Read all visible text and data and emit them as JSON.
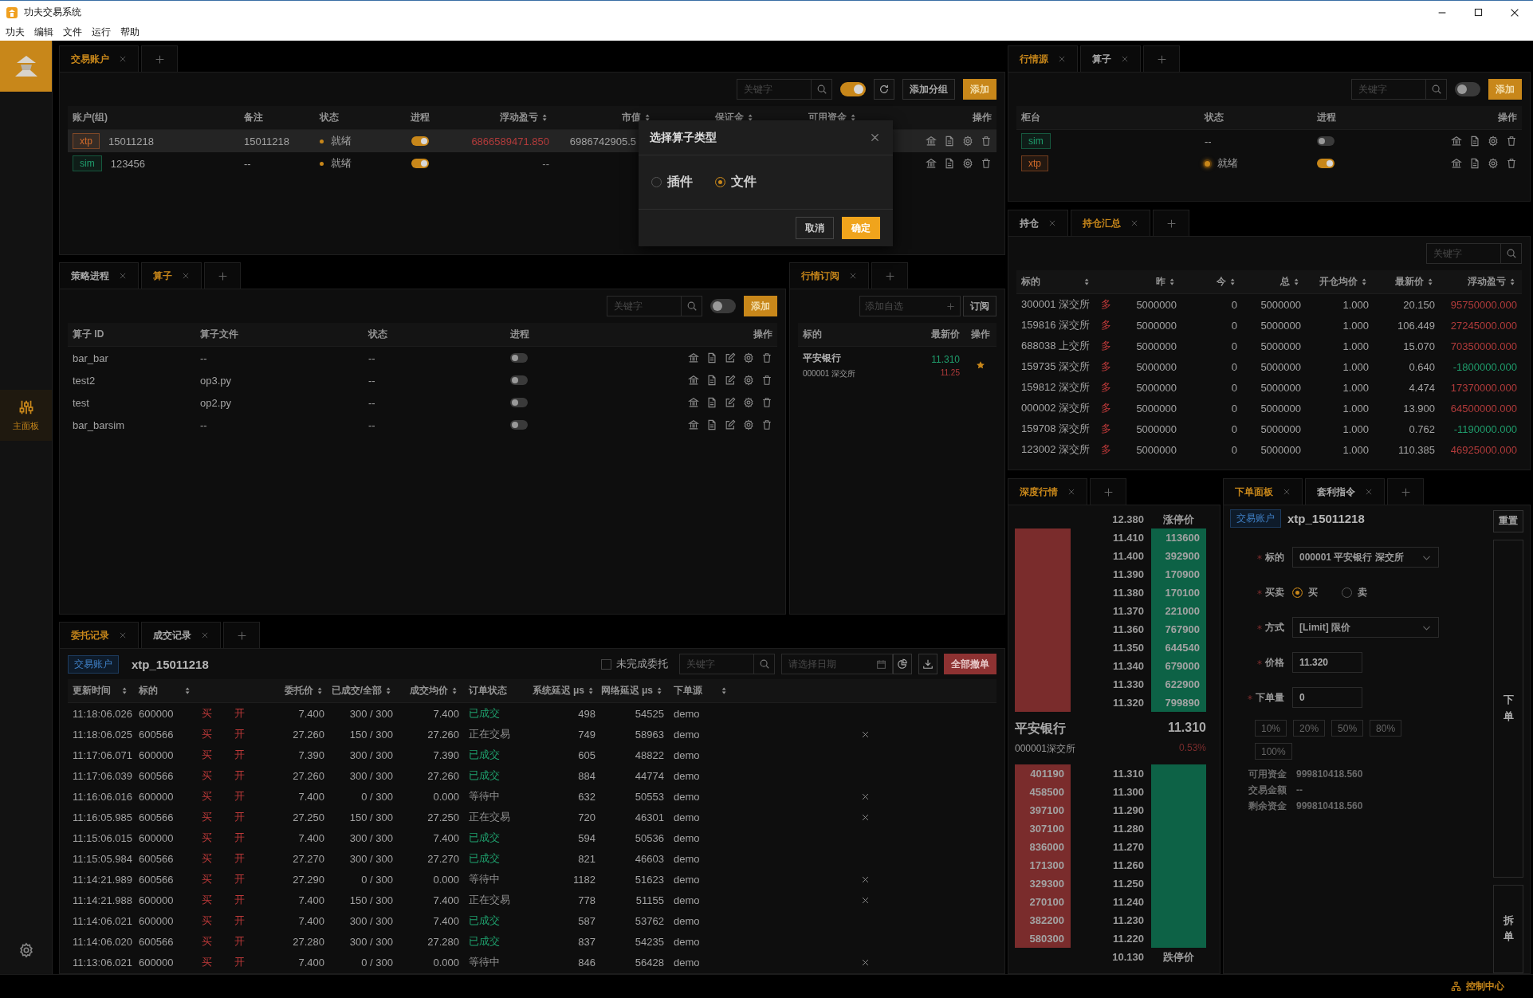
{
  "window": {
    "title": "功夫交易系统"
  },
  "menu": [
    "功夫",
    "编辑",
    "文件",
    "运行",
    "帮助"
  ],
  "sidebar": {
    "items": [
      {
        "label": "主面板",
        "selected": true
      }
    ]
  },
  "account_panel": {
    "tabs": [
      {
        "label": "交易账户",
        "selected": true
      }
    ],
    "search": {
      "placeholder": "关键字"
    },
    "toggle_on": true,
    "buttons": [
      {
        "label": "添加分组",
        "kind": "default"
      },
      {
        "label": "添加",
        "kind": "primary"
      }
    ],
    "columns": [
      {
        "label": "账户(组)",
        "sortable": false
      },
      {
        "label": "备注",
        "sortable": false
      },
      {
        "label": "状态",
        "sortable": false
      },
      {
        "label": "进程",
        "sortable": false
      },
      {
        "label": "浮动盈亏",
        "sortable": true
      },
      {
        "label": "市值",
        "sortable": true
      },
      {
        "label": "保证金",
        "sortable": true
      },
      {
        "label": "可用资金",
        "sortable": true
      },
      {
        "label": "操作",
        "sortable": false
      }
    ],
    "rows": [
      {
        "tag": "xtp",
        "color": "#d06a2a",
        "account": "15011218",
        "note": "15011218",
        "status": "就绪",
        "ready": true,
        "process_on": true,
        "pnl": "6866589471.850",
        "pnl_up": true,
        "market_value": "6986742905.5",
        "selected": true
      },
      {
        "tag": "sim",
        "color": "#1f9d6c",
        "account": "123456",
        "note": "--",
        "status": "就绪",
        "ready": true,
        "process_on": true,
        "pnl": "--",
        "pnl_up": false,
        "selected": false
      }
    ]
  },
  "strategy_panel": {
    "tabs": [
      {
        "label": "策略进程",
        "selected": false
      },
      {
        "label": "算子",
        "selected": true
      }
    ],
    "search": {
      "placeholder": "关键字"
    },
    "toggle_on": false,
    "add_button": "添加",
    "columns": [
      {
        "label": "算子 ID"
      },
      {
        "label": "算子文件"
      },
      {
        "label": "状态"
      },
      {
        "label": "进程"
      },
      {
        "label": "操作"
      }
    ],
    "rows": [
      {
        "id": "bar_bar",
        "file": "--",
        "status": "--",
        "process_on": false
      },
      {
        "id": "test2",
        "file": "op3.py",
        "status": "--",
        "process_on": false
      },
      {
        "id": "test",
        "file": "op2.py",
        "status": "--",
        "process_on": false
      },
      {
        "id": "bar_barsim",
        "file": "--",
        "status": "--",
        "process_on": false
      }
    ]
  },
  "subscription_panel": {
    "tabs": [
      {
        "label": "行情订阅",
        "selected": true
      }
    ],
    "add_field": {
      "placeholder": "添加自选"
    },
    "subscribe_button": "订阅",
    "columns": [
      {
        "label": "标的"
      },
      {
        "label": "最新价"
      },
      {
        "label": "操作"
      }
    ],
    "rows": [
      {
        "name": "平安银行",
        "code": "000001 深交所",
        "last": "11.310",
        "prev": "11.25",
        "starred": true
      }
    ]
  },
  "orders_panel": {
    "tabs": [
      {
        "label": "委托记录",
        "selected": true
      },
      {
        "label": "成交记录",
        "selected": false
      }
    ],
    "account_badge": "交易账户",
    "account": "xtp_15011218",
    "filter_checkbox": {
      "label": "未完成委托",
      "checked": false
    },
    "search": {
      "placeholder": "关键字"
    },
    "date_field": {
      "placeholder": "请选择日期"
    },
    "cancel_all_button": "全部撤单",
    "columns": [
      {
        "label": "更新时间",
        "sortable": true
      },
      {
        "label": "标的",
        "sortable": true
      },
      null,
      null,
      {
        "label": "委托价",
        "sortable": true
      },
      {
        "label": "已成交/全部",
        "sortable": true
      },
      {
        "label": "成交均价",
        "sortable": true
      },
      {
        "label": "订单状态",
        "sortable": false
      },
      {
        "label": "系统延迟 μs",
        "sortable": true
      },
      {
        "label": "网络延迟 μs",
        "sortable": true
      },
      {
        "label": "下单源",
        "sortable": true
      },
      null
    ],
    "rows": [
      {
        "time": "11:18:06.026",
        "code": "600000",
        "side": "买",
        "offset": "开",
        "price": "7.400",
        "filled": "300 / 300",
        "avg_price": "7.400",
        "status": "已成交",
        "filled_status": true,
        "sys_latency": "498",
        "net_latency": "54525",
        "source": "demo",
        "cancelable": false
      },
      {
        "time": "11:18:06.025",
        "code": "600566",
        "side": "买",
        "offset": "开",
        "price": "27.260",
        "filled": "150 / 300",
        "avg_price": "27.260",
        "status": "正在交易",
        "filled_status": false,
        "sys_latency": "749",
        "net_latency": "58963",
        "source": "demo",
        "cancelable": true
      },
      {
        "time": "11:17:06.071",
        "code": "600000",
        "side": "买",
        "offset": "开",
        "price": "7.390",
        "filled": "300 / 300",
        "avg_price": "7.390",
        "status": "已成交",
        "filled_status": true,
        "sys_latency": "605",
        "net_latency": "48822",
        "source": "demo",
        "cancelable": false
      },
      {
        "time": "11:17:06.039",
        "code": "600566",
        "side": "买",
        "offset": "开",
        "price": "27.260",
        "filled": "300 / 300",
        "avg_price": "27.260",
        "status": "已成交",
        "filled_status": true,
        "sys_latency": "884",
        "net_latency": "44774",
        "source": "demo",
        "cancelable": false
      },
      {
        "time": "11:16:06.016",
        "code": "600000",
        "side": "买",
        "offset": "开",
        "price": "7.400",
        "filled": "0 / 300",
        "avg_price": "0.000",
        "status": "等待中",
        "filled_status": false,
        "sys_latency": "632",
        "net_latency": "50553",
        "source": "demo",
        "cancelable": true
      },
      {
        "time": "11:16:05.985",
        "code": "600566",
        "side": "买",
        "offset": "开",
        "price": "27.250",
        "filled": "150 / 300",
        "avg_price": "27.250",
        "status": "正在交易",
        "filled_status": false,
        "sys_latency": "720",
        "net_latency": "46301",
        "source": "demo",
        "cancelable": true
      },
      {
        "time": "11:15:06.015",
        "code": "600000",
        "side": "买",
        "offset": "开",
        "price": "7.400",
        "filled": "300 / 300",
        "avg_price": "7.400",
        "status": "已成交",
        "filled_status": true,
        "sys_latency": "594",
        "net_latency": "50536",
        "source": "demo",
        "cancelable": false
      },
      {
        "time": "11:15:05.984",
        "code": "600566",
        "side": "买",
        "offset": "开",
        "price": "27.270",
        "filled": "300 / 300",
        "avg_price": "27.270",
        "status": "已成交",
        "filled_status": true,
        "sys_latency": "821",
        "net_latency": "46603",
        "source": "demo",
        "cancelable": false
      },
      {
        "time": "11:14:21.989",
        "code": "600566",
        "side": "买",
        "offset": "开",
        "price": "27.290",
        "filled": "0 / 300",
        "avg_price": "0.000",
        "status": "等待中",
        "filled_status": false,
        "sys_latency": "1182",
        "net_latency": "51623",
        "source": "demo",
        "cancelable": true
      },
      {
        "time": "11:14:21.988",
        "code": "600000",
        "side": "买",
        "offset": "开",
        "price": "7.400",
        "filled": "150 / 300",
        "avg_price": "7.400",
        "status": "正在交易",
        "filled_status": false,
        "sys_latency": "778",
        "net_latency": "51155",
        "source": "demo",
        "cancelable": true
      },
      {
        "time": "11:14:06.021",
        "code": "600000",
        "side": "买",
        "offset": "开",
        "price": "7.400",
        "filled": "300 / 300",
        "avg_price": "7.400",
        "status": "已成交",
        "filled_status": true,
        "sys_latency": "587",
        "net_latency": "53762",
        "source": "demo",
        "cancelable": false
      },
      {
        "time": "11:14:06.020",
        "code": "600566",
        "side": "买",
        "offset": "开",
        "price": "27.280",
        "filled": "300 / 300",
        "avg_price": "27.280",
        "status": "已成交",
        "filled_status": true,
        "sys_latency": "837",
        "net_latency": "54235",
        "source": "demo",
        "cancelable": false
      },
      {
        "time": "11:13:06.021",
        "code": "600000",
        "side": "买",
        "offset": "开",
        "price": "7.400",
        "filled": "0 / 300",
        "avg_price": "0.000",
        "status": "等待中",
        "filled_status": false,
        "sys_latency": "846",
        "net_latency": "56428",
        "source": "demo",
        "cancelable": true
      }
    ]
  },
  "source_panel": {
    "tabs": [
      {
        "label": "行情源",
        "selected": true
      },
      {
        "label": "算子",
        "selected": false
      }
    ],
    "search": {
      "placeholder": "关键字"
    },
    "toggle_on": false,
    "add_button": "添加",
    "columns": [
      {
        "label": "柜台"
      },
      {
        "label": "状态"
      },
      {
        "label": "进程"
      },
      {
        "label": "操作"
      }
    ],
    "rows": [
      {
        "tag": "sim",
        "color": "#1f9d6c",
        "status": "--",
        "ready": false,
        "process_on": false
      },
      {
        "tag": "xtp",
        "color": "#d06a2a",
        "status": "就绪",
        "ready": true,
        "process_on": true
      }
    ]
  },
  "positions_panel": {
    "tabs": [
      {
        "label": "持仓",
        "selected": false
      },
      {
        "label": "持仓汇总",
        "selected": true
      }
    ],
    "search": {
      "placeholder": "关键字"
    },
    "columns": [
      {
        "label": "标的",
        "sortable": true
      },
      null,
      {
        "label": "昨",
        "sortable": true
      },
      {
        "label": "今",
        "sortable": true
      },
      {
        "label": "总",
        "sortable": true
      },
      {
        "label": "开仓均价",
        "sortable": true
      },
      {
        "label": "最新价",
        "sortable": true
      },
      {
        "label": "浮动盈亏",
        "sortable": true
      }
    ],
    "rows": [
      {
        "instrument": "300001 深交所",
        "direction": "多",
        "yesterday": "5000000",
        "today": "0",
        "total": "5000000",
        "avg_price": "1.000",
        "last": "20.150",
        "pnl": "95750000.000",
        "loss": false
      },
      {
        "instrument": "159816 深交所",
        "direction": "多",
        "yesterday": "5000000",
        "today": "0",
        "total": "5000000",
        "avg_price": "1.000",
        "last": "106.449",
        "pnl": "27245000.000",
        "loss": false
      },
      {
        "instrument": "688038 上交所",
        "direction": "多",
        "yesterday": "5000000",
        "today": "0",
        "total": "5000000",
        "avg_price": "1.000",
        "last": "15.070",
        "pnl": "70350000.000",
        "loss": false
      },
      {
        "instrument": "159735 深交所",
        "direction": "多",
        "yesterday": "5000000",
        "today": "0",
        "total": "5000000",
        "avg_price": "1.000",
        "last": "0.640",
        "pnl": "-1800000.000",
        "loss": true
      },
      {
        "instrument": "159812 深交所",
        "direction": "多",
        "yesterday": "5000000",
        "today": "0",
        "total": "5000000",
        "avg_price": "1.000",
        "last": "4.474",
        "pnl": "17370000.000",
        "loss": false
      },
      {
        "instrument": "000002 深交所",
        "direction": "多",
        "yesterday": "5000000",
        "today": "0",
        "total": "5000000",
        "avg_price": "1.000",
        "last": "13.900",
        "pnl": "64500000.000",
        "loss": false
      },
      {
        "instrument": "159708 深交所",
        "direction": "多",
        "yesterday": "5000000",
        "today": "0",
        "total": "5000000",
        "avg_price": "1.000",
        "last": "0.762",
        "pnl": "-1190000.000",
        "loss": true
      },
      {
        "instrument": "123002 深交所",
        "direction": "多",
        "yesterday": "5000000",
        "today": "0",
        "total": "5000000",
        "avg_price": "1.000",
        "last": "110.385",
        "pnl": "46925000.000",
        "loss": false
      }
    ]
  },
  "depth_panel": {
    "tabs": [
      {
        "label": "深度行情",
        "selected": true
      }
    ],
    "upper_limit": {
      "price": "12.380",
      "label": "涨停价"
    },
    "asks": [
      {
        "price": "11.410",
        "volume": "113600"
      },
      {
        "price": "11.400",
        "volume": "392900"
      },
      {
        "price": "11.390",
        "volume": "170900"
      },
      {
        "price": "11.380",
        "volume": "170100"
      },
      {
        "price": "11.370",
        "volume": "221000"
      },
      {
        "price": "11.360",
        "volume": "767900"
      },
      {
        "price": "11.350",
        "volume": "644540"
      },
      {
        "price": "11.340",
        "volume": "679000"
      },
      {
        "price": "11.330",
        "volume": "622900"
      },
      {
        "price": "11.320",
        "volume": "799890"
      }
    ],
    "name": "平安银行",
    "code": "000001深交所",
    "last": "11.310",
    "change": "0.53%",
    "bids": [
      {
        "price": "11.310",
        "volume": "401190"
      },
      {
        "price": "11.300",
        "volume": "458500"
      },
      {
        "price": "11.290",
        "volume": "397100"
      },
      {
        "price": "11.280",
        "volume": "307100"
      },
      {
        "price": "11.270",
        "volume": "836000"
      },
      {
        "price": "11.260",
        "volume": "171300"
      },
      {
        "price": "11.250",
        "volume": "329300"
      },
      {
        "price": "11.240",
        "volume": "270100"
      },
      {
        "price": "11.230",
        "volume": "382200"
      },
      {
        "price": "11.220",
        "volume": "580300"
      }
    ],
    "lower_limit": {
      "price": "10.130",
      "label": "跌停价"
    }
  },
  "order_panel": {
    "tabs": [
      {
        "label": "下单面板",
        "selected": true
      },
      {
        "label": "套利指令",
        "selected": false
      }
    ],
    "account_badge": "交易账户",
    "account": "xtp_15011218",
    "reset_button": "重置",
    "fields": [
      {
        "kind": "select",
        "label": "标的",
        "required": true,
        "value": "000001 平安银行 深交所"
      },
      {
        "kind": "radio",
        "label": "买卖",
        "required": true,
        "options": [
          {
            "label": "买",
            "selected": true
          },
          {
            "label": "卖",
            "selected": false
          }
        ]
      },
      {
        "kind": "select",
        "label": "方式",
        "required": true,
        "value": "[Limit] 限价"
      },
      {
        "kind": "input",
        "label": "价格",
        "required": true,
        "value": "11.320"
      },
      {
        "kind": "input",
        "label": "下单量",
        "required": true,
        "value": "0"
      }
    ],
    "percent_buttons": [
      {
        "label": "10%",
        "disabled": true
      },
      {
        "label": "20%",
        "disabled": true
      },
      {
        "label": "50%",
        "disabled": true
      },
      {
        "label": "80%",
        "disabled": true
      },
      {
        "label": "100%",
        "disabled": true
      }
    ],
    "summary": [
      {
        "label": "可用资金",
        "value": "999810418.560"
      },
      {
        "label": "交易金额",
        "value": "--"
      },
      {
        "label": "剩余资金",
        "value": "999810418.560"
      }
    ],
    "submit_button": "下单",
    "split_button": "拆单"
  },
  "dialog": {
    "title": "选择算子类型",
    "options": [
      {
        "label": "插件",
        "selected": false
      },
      {
        "label": "文件",
        "selected": true
      }
    ],
    "buttons": [
      {
        "label": "取消",
        "kind": "default"
      },
      {
        "label": "确定",
        "kind": "primary"
      }
    ]
  },
  "status_bar": {
    "label": "控制中心"
  }
}
